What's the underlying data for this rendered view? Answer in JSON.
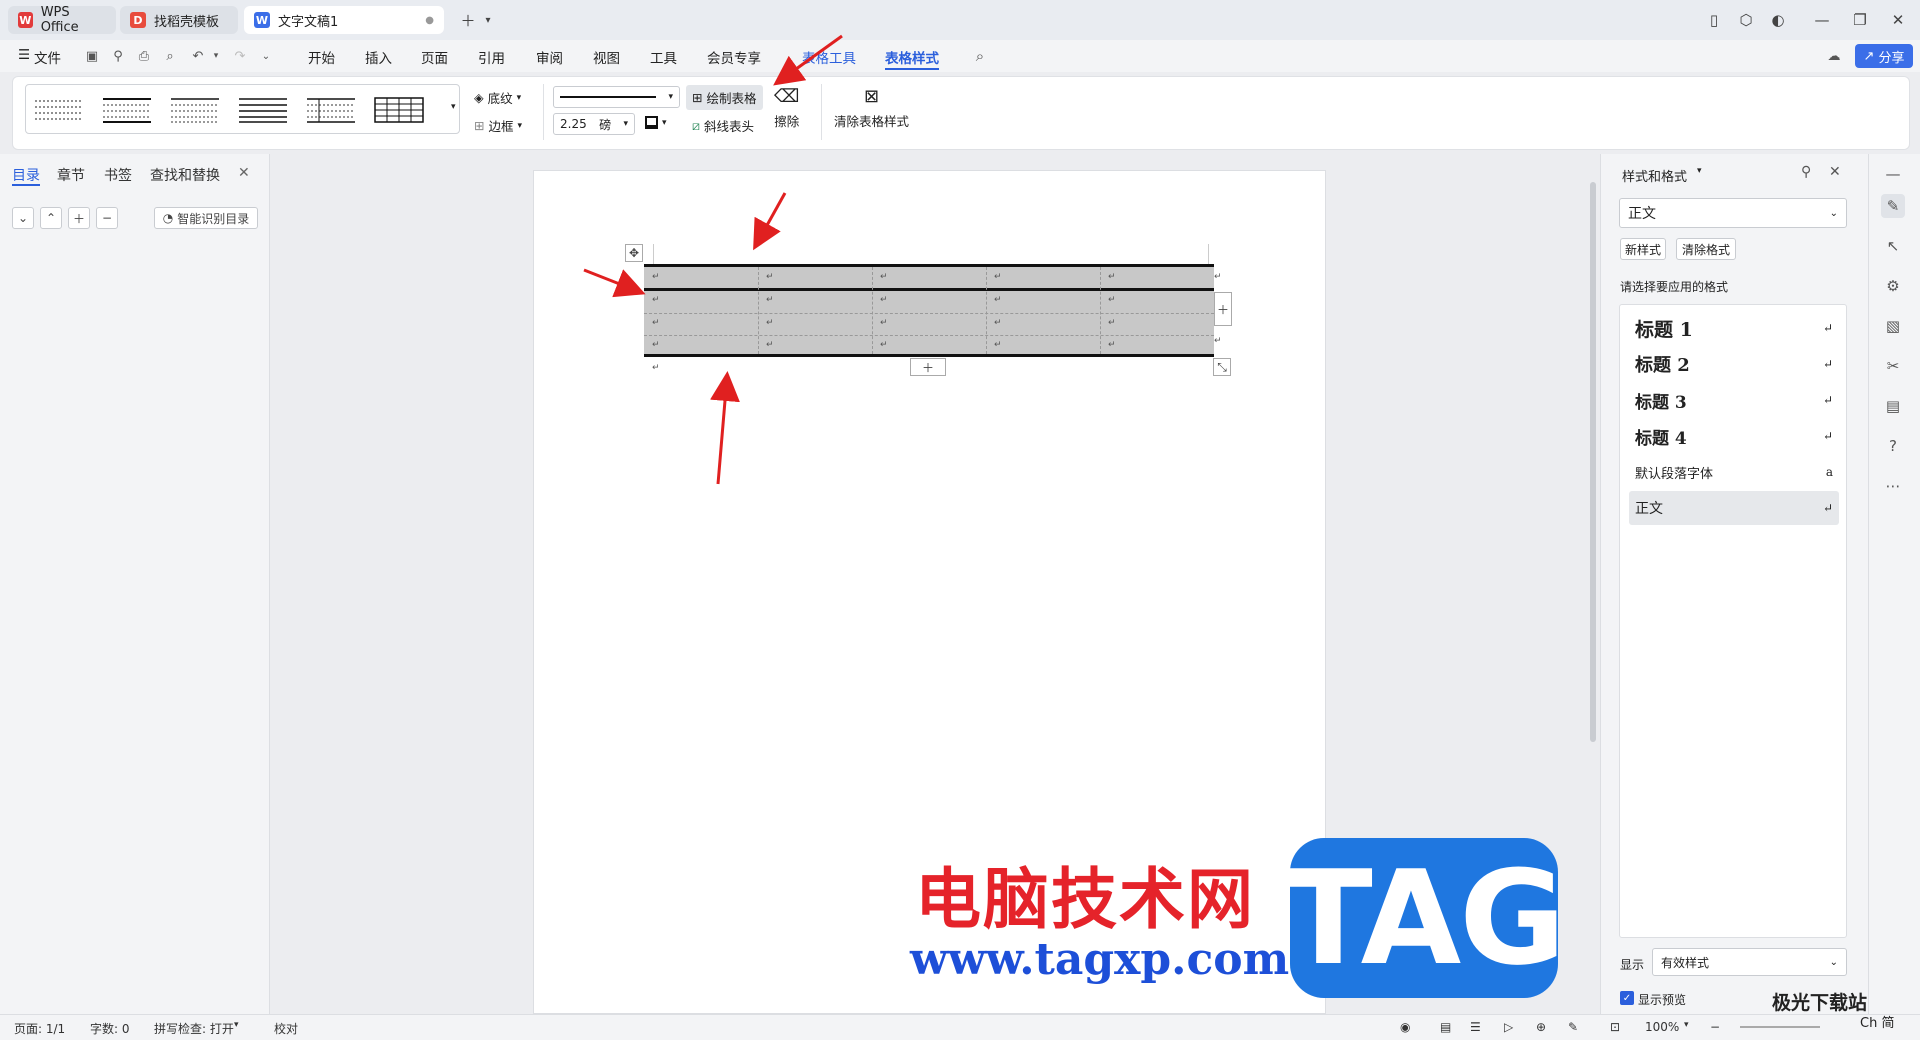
{
  "titlebar": {
    "tabs": [
      {
        "label": "WPS Office"
      },
      {
        "label": "找稻壳模板"
      },
      {
        "label": "文字文稿1"
      }
    ]
  },
  "menubar": {
    "file": "文件",
    "items": [
      "开始",
      "插入",
      "页面",
      "引用",
      "审阅",
      "视图",
      "工具",
      "会员专享",
      "表格工具",
      "表格样式"
    ],
    "share": "分享"
  },
  "ribbon": {
    "shading": "底纹",
    "border": "边框",
    "line_width": "2.25",
    "line_unit": "磅",
    "draw_table": "绘制表格",
    "diagonal_header": "斜线表头",
    "erase": "擦除",
    "clear_style": "清除表格样式"
  },
  "left_panel": {
    "tabs": [
      "目录",
      "章节",
      "书签",
      "查找和替换"
    ],
    "smart_toc": "智能识别目录"
  },
  "right_panel": {
    "title": "样式和格式",
    "current_style": "正文",
    "new_style": "新样式",
    "clear_format": "清除格式",
    "prompt": "请选择要应用的格式",
    "styles": [
      {
        "label": "标题  1"
      },
      {
        "label": "标题  2"
      },
      {
        "label": "标题  3"
      },
      {
        "label": "标题  4"
      },
      {
        "label": "默认段落字体"
      },
      {
        "label": "正文"
      }
    ],
    "show_label": "显示",
    "show_value": "有效样式",
    "preview_label": "显示预览"
  },
  "statusbar": {
    "page": "页面: 1/1",
    "words": "字数: 0",
    "spell": "拼写检查: 打开",
    "proof": "校对",
    "zoom": "100%"
  },
  "watermark": {
    "site_name": "电脑技术网",
    "url": "www.tagxp.com",
    "tag": "TAG",
    "corner": "极光下载站",
    "corner2": "Ch 简"
  },
  "colors": {
    "accent": "#2b5fdc",
    "annotation_arrow": "#e02020",
    "table_fill": "#c8c8c8"
  }
}
